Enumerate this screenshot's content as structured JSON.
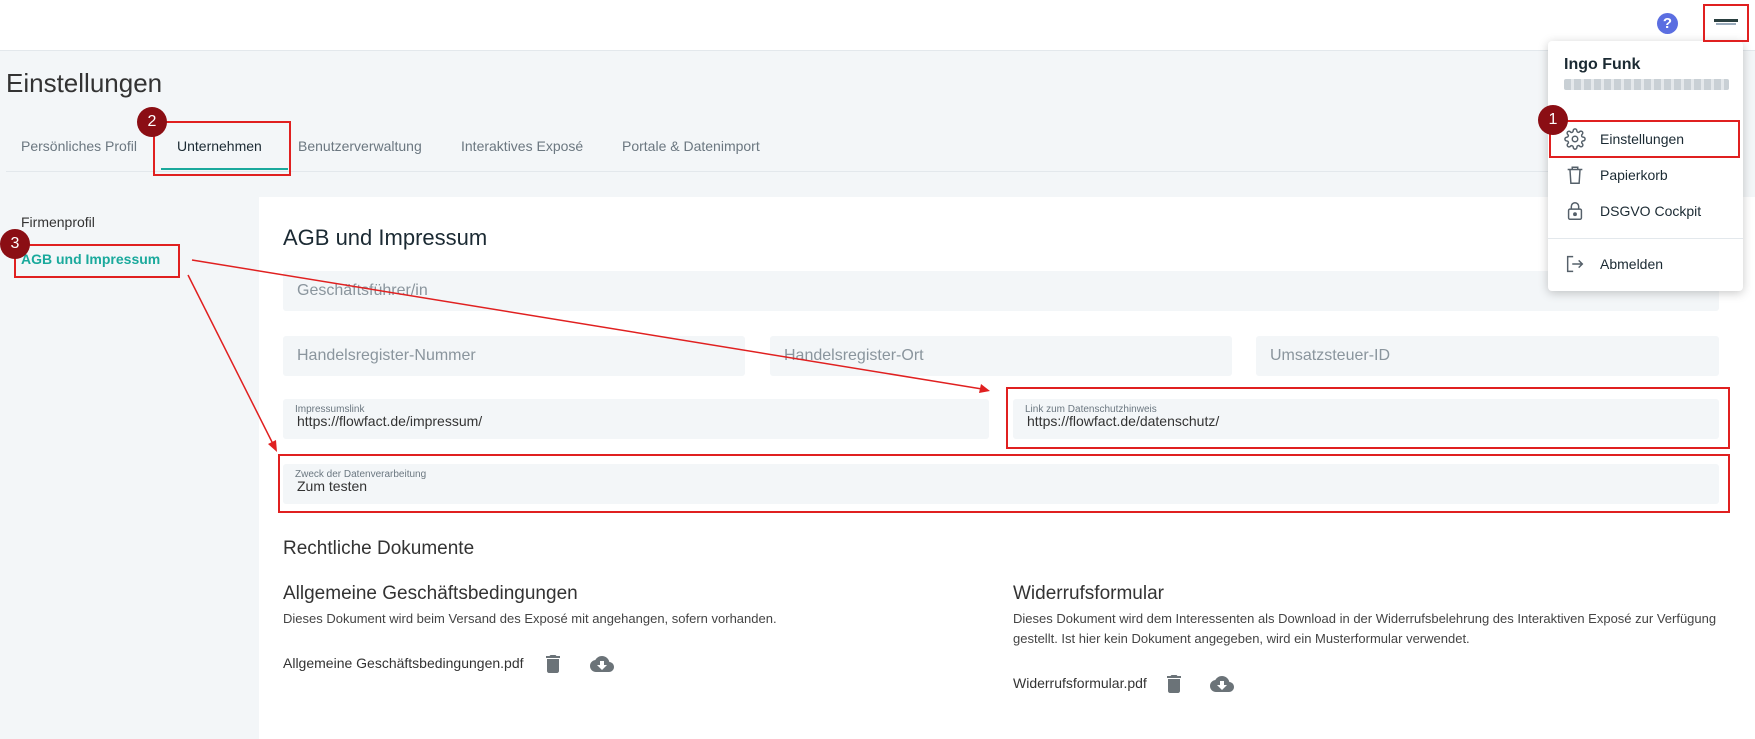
{
  "header": {
    "help_icon": "question-circle-icon",
    "avatar_icon": "company-logo-icon"
  },
  "page": {
    "title": "Einstellungen"
  },
  "tabs": [
    {
      "label": "Persönliches Profil"
    },
    {
      "label": "Unternehmen"
    },
    {
      "label": "Benutzerverwaltung"
    },
    {
      "label": "Interaktives Exposé"
    },
    {
      "label": "Portale & Datenimport"
    }
  ],
  "sidebar": {
    "items": [
      {
        "label": "Firmenprofil"
      },
      {
        "label": "AGB und Impressum"
      }
    ]
  },
  "form": {
    "title": "AGB und Impressum",
    "geschaeftsfuehrer": {
      "placeholder": "Geschäftsführer/in"
    },
    "hr_nummer": {
      "placeholder": "Handelsregister-Nummer"
    },
    "hr_ort": {
      "placeholder": "Handelsregister-Ort"
    },
    "ust_id": {
      "placeholder": "Umsatzsteuer-ID"
    },
    "impressum": {
      "label": "Impressumslink",
      "value": "https://flowfact.de/impressum/"
    },
    "datenschutz": {
      "label": "Link zum Datenschutzhinweis",
      "value": "https://flowfact.de/datenschutz/"
    },
    "zweck": {
      "label": "Zweck der Datenverarbeitung",
      "value": "Zum testen"
    }
  },
  "documents": {
    "section_title": "Rechtliche Dokumente",
    "agb": {
      "title": "Allgemeine Geschäftsbedingungen",
      "description": "Dieses Dokument wird beim Versand des Exposé mit angehangen, sofern vorhanden.",
      "file": "Allgemeine Geschäftsbedingungen.pdf"
    },
    "widerruf": {
      "title": "Widerrufsformular",
      "description": "Dieses Dokument wird dem Interessenten als Download in der Widerrufsbelehrung des Interaktiven Exposé zur Verfügung gestellt. Ist hier kein Dokument angegeben, wird ein Musterformular verwendet.",
      "file": "Widerrufsformular.pdf"
    }
  },
  "user_menu": {
    "name": "Ingo Funk",
    "items": [
      {
        "label": "Einstellungen",
        "icon": "gear-icon"
      },
      {
        "label": "Papierkorb",
        "icon": "trash-icon"
      },
      {
        "label": "DSGVO Cockpit",
        "icon": "lock-icon"
      },
      {
        "label": "Abmelden",
        "icon": "logout-icon"
      }
    ]
  },
  "annotations": {
    "badges": [
      "1",
      "2",
      "3"
    ],
    "highlight_color": "#e02020",
    "badge_color": "#8b0e14"
  },
  "colors": {
    "accent": "#1aa99c",
    "help": "#5b6ee1"
  }
}
